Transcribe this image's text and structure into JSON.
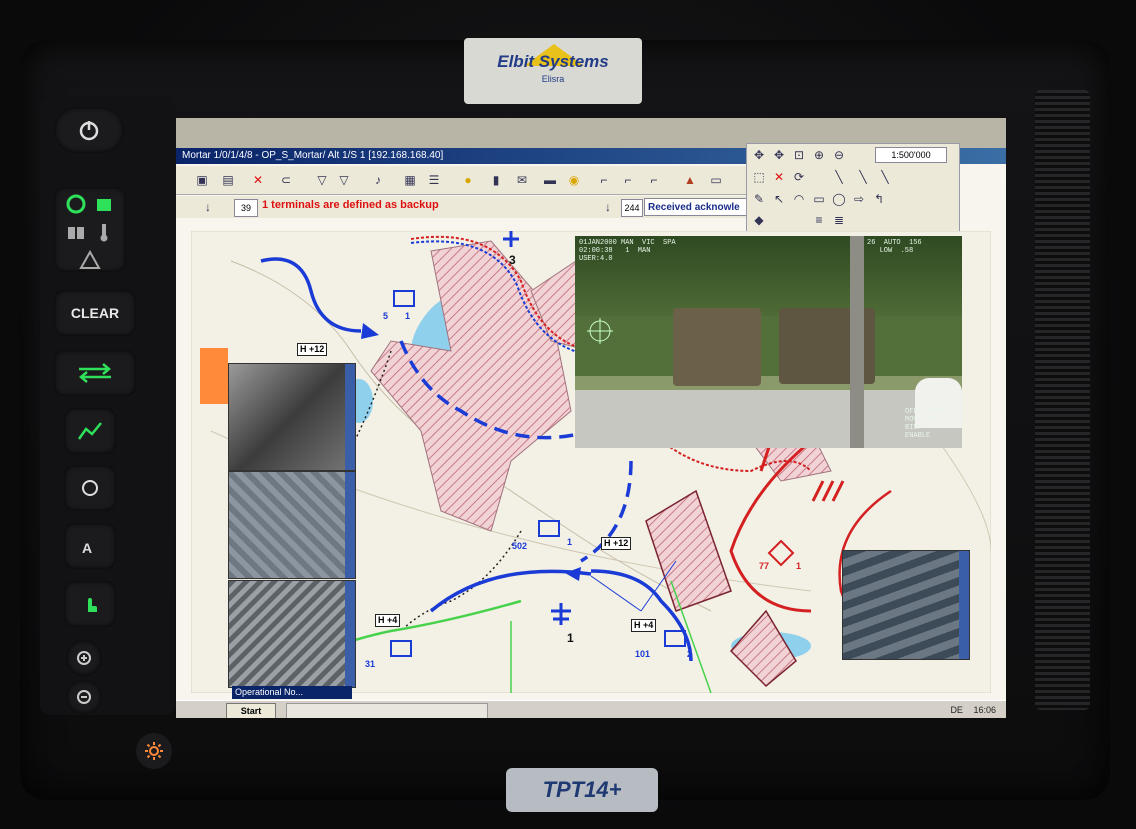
{
  "device": {
    "brand": "Elbit Systems",
    "brand_tagline": "Elisra",
    "model": "TPT14+",
    "side_buttons": [
      {
        "name": "power-icon",
        "label": ""
      },
      {
        "name": "clear-button",
        "label": "CLEAR"
      }
    ]
  },
  "window": {
    "title": "Mortar 1/0/1/4/8 - OP_S_Mortar/ Alt 1/S 1 [192.168.168.40]"
  },
  "toolbar": {
    "warning_text": "1 terminals are defined as backup",
    "message_count": "39",
    "message_seq": "244",
    "received_text": "Received acknowle",
    "scale": "1:500'000"
  },
  "video": {
    "osd_top_left": "01JAN2000 MAN  VIC  SPA\n02:00:38   1  MAN\nUSER:4.0",
    "osd_top_right": "26  AUTO  156\n   LOW  .58",
    "osd_right_bottom": "OFF  ↓NONE\nMOV  TGT\nBINF\nENABLE\n"
  },
  "map": {
    "labels": [
      {
        "text": "H +12"
      },
      {
        "text": "H +12"
      },
      {
        "text": "H +4"
      },
      {
        "text": "H +4"
      }
    ],
    "unit_numbers": [
      "5",
      "1",
      "502",
      "1",
      "101",
      "2",
      "1",
      "3",
      "77",
      "1",
      "31"
    ]
  },
  "thumbnails": {
    "panel_title": "Operational No..."
  },
  "taskbar": {
    "start_label": "Start",
    "tray_lang": "DE",
    "tray_time": "16:06"
  },
  "colors": {
    "friendly": "#1a3bd6",
    "hostile": "#d42020",
    "route": "#46d24a",
    "hatch": "#c97a86"
  }
}
